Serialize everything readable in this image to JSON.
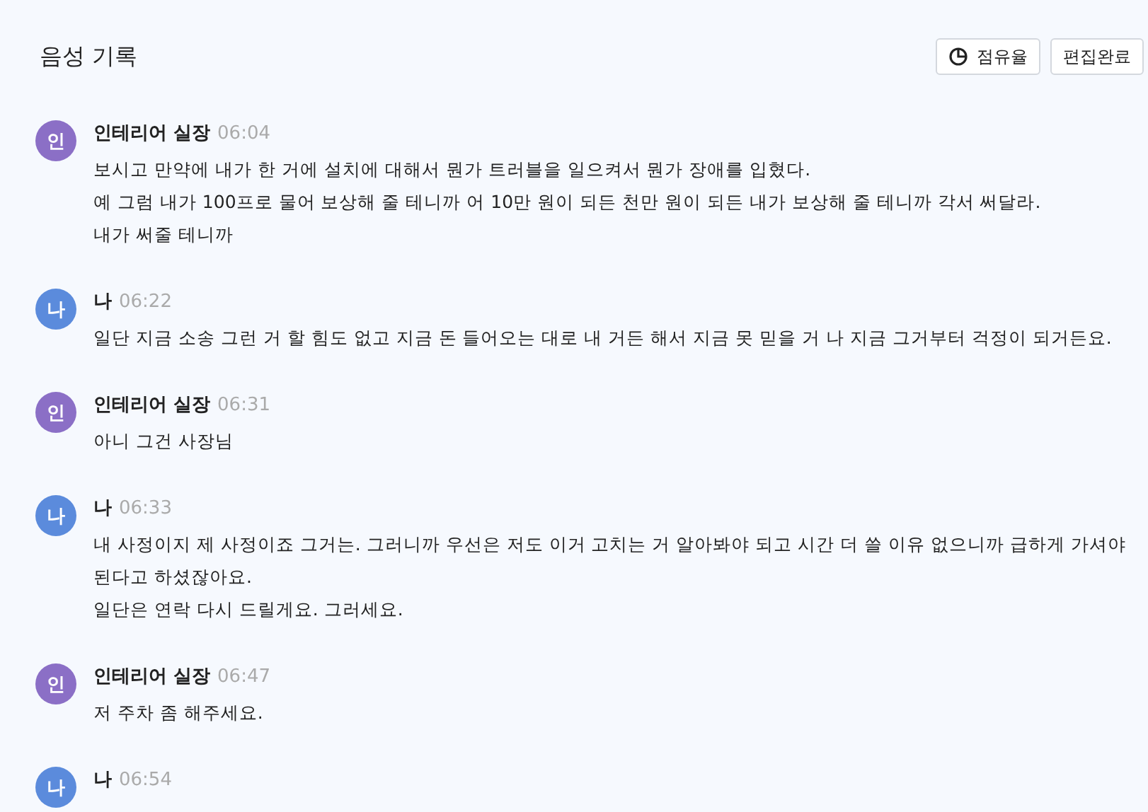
{
  "title": "음성 기록",
  "buttons": [
    {
      "kind": "share",
      "label": "점유율"
    },
    {
      "kind": "plain",
      "label": "편집완료"
    }
  ],
  "messages": [
    {
      "avatar": "인",
      "color": "#8b6fc6",
      "speaker": "인테리어 실장",
      "time": "06:04",
      "lines": [
        "보시고 만약에 내가 한 거에 설치에 대해서 뭔가 트러블을 일으켜서 뭔가 장애를 입혔다.",
        "예 그럼 내가 100프로 물어 보상해 줄 테니까 어 10만 원이 되든 천만 원이 되든 내가 보상해 줄 테니까 각서 써달라.",
        "내가 써줄 테니까"
      ]
    },
    {
      "avatar": "나",
      "color": "#5b8bdc",
      "speaker": "나",
      "time": "06:22",
      "lines": [
        "일단 지금 소송 그런 거 할 힘도 없고 지금 돈 들어오는 대로 내 거든 해서 지금 못 믿을 거 나 지금 그거부터 걱정이 되거든요."
      ]
    },
    {
      "avatar": "인",
      "color": "#8b6fc6",
      "speaker": "인테리어 실장",
      "time": "06:31",
      "lines": [
        "아니 그건 사장님"
      ]
    },
    {
      "avatar": "나",
      "color": "#5b8bdc",
      "speaker": "나",
      "time": "06:33",
      "lines": [
        "내 사정이지 제 사정이죠 그거는. 그러니까 우선은 저도 이거 고치는 거 알아봐야 되고 시간 더 쓸 이유 없으니까 급하게 가셔야 된다고 하셨잖아요.",
        "일단은 연락 다시 드릴게요. 그러세요."
      ]
    },
    {
      "avatar": "인",
      "color": "#8b6fc6",
      "speaker": "인테리어 실장",
      "time": "06:47",
      "lines": [
        "저 주차 좀 해주세요."
      ]
    },
    {
      "avatar": "나",
      "color": "#5b8bdc",
      "speaker": "나",
      "time": "06:54"
    }
  ]
}
